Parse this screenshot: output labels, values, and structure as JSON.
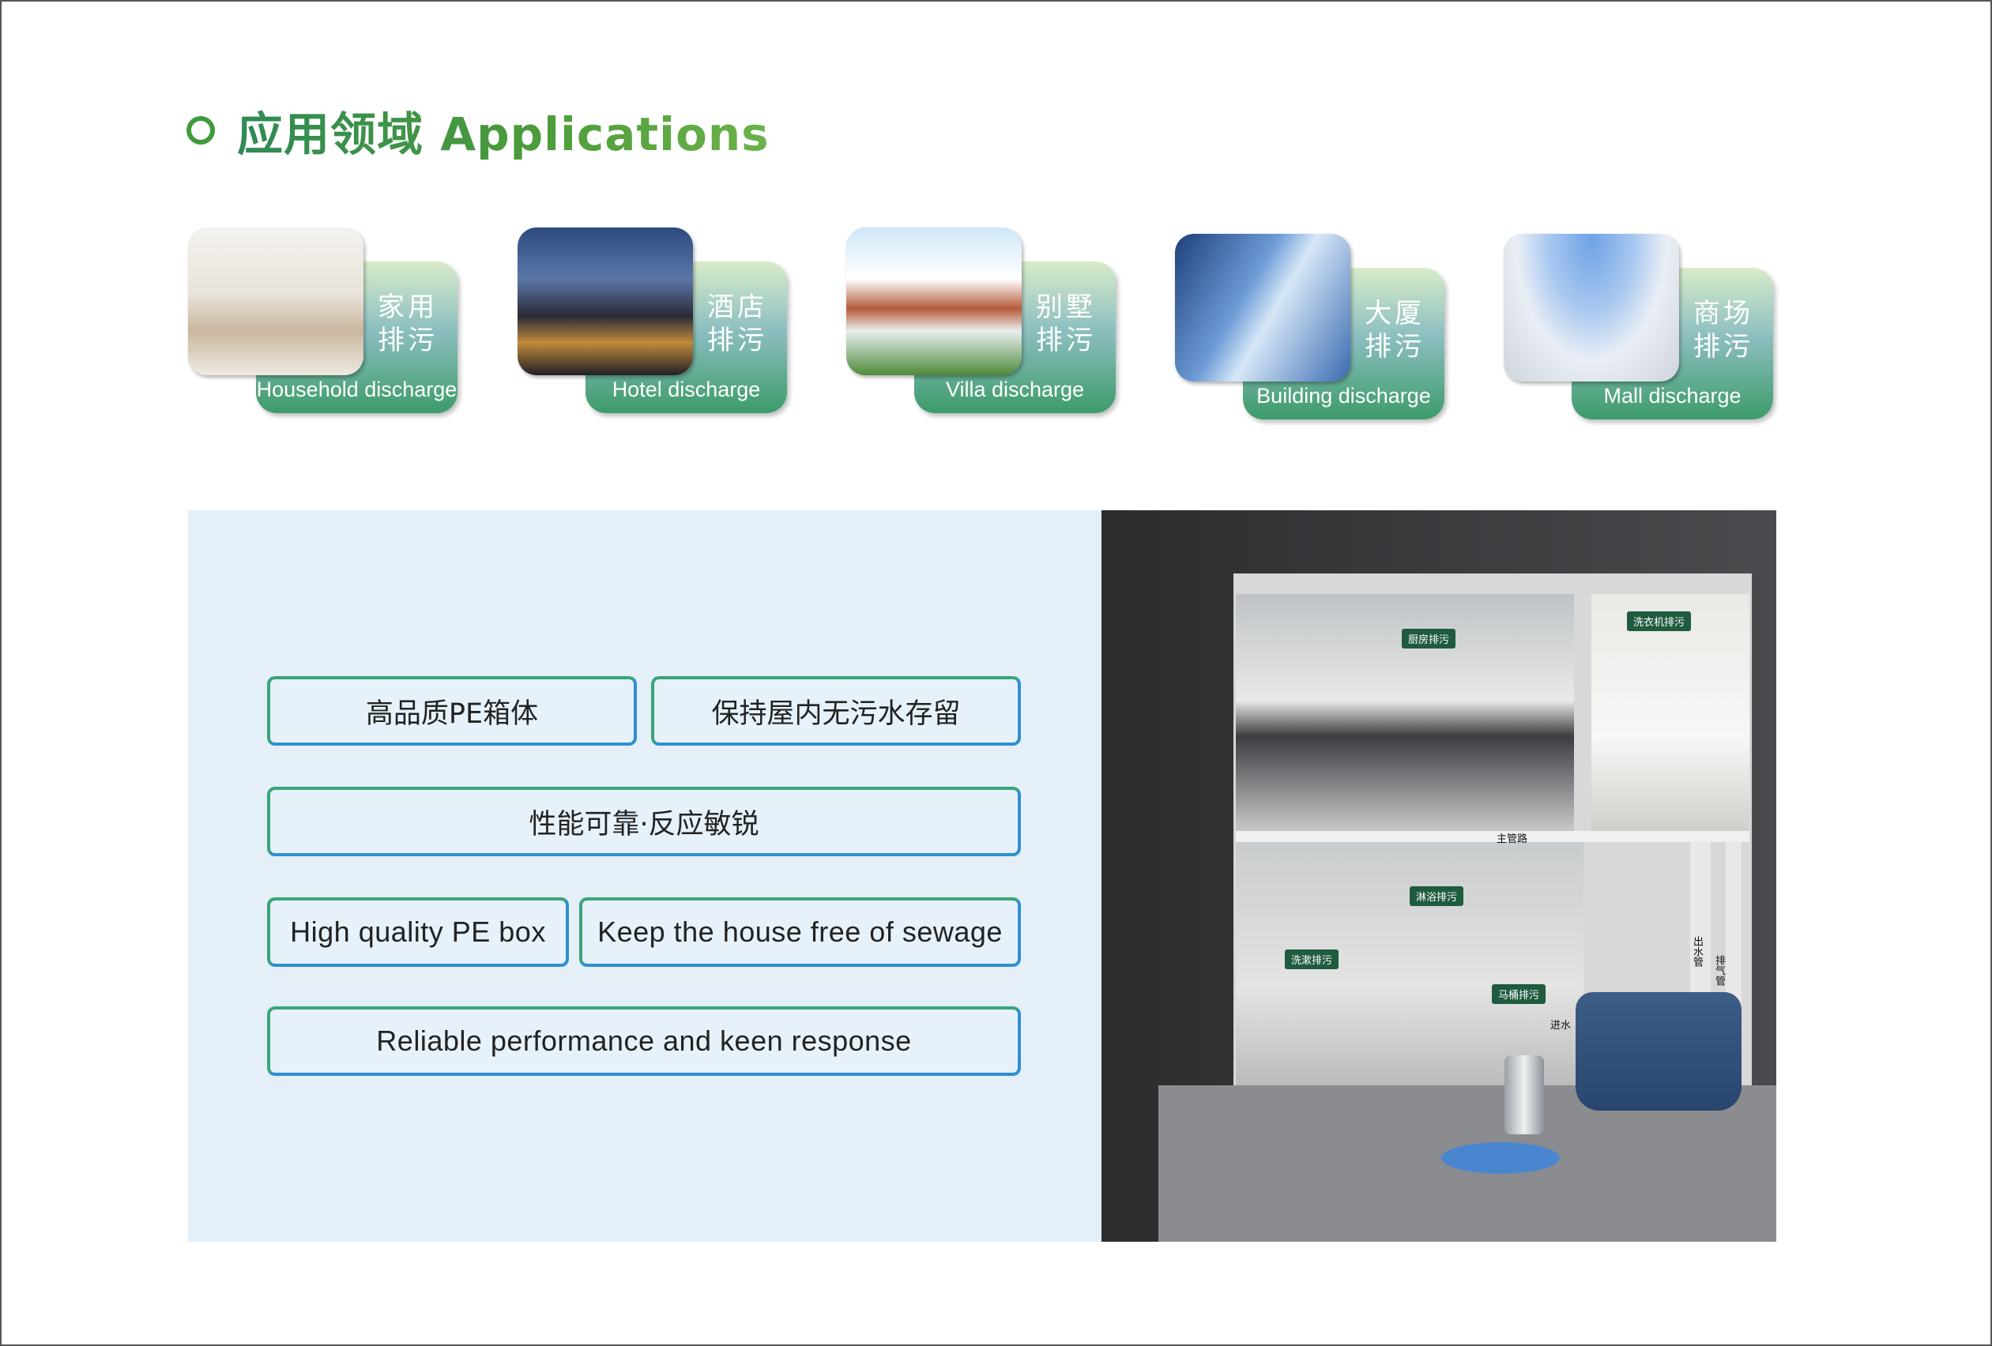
{
  "header": {
    "title": "应用领域 Applications"
  },
  "applications": [
    {
      "cn": "家用\n排污",
      "en": "Household discharge",
      "photo": "living-room"
    },
    {
      "cn": "酒店\n排污",
      "en": "Hotel discharge",
      "photo": "hotel-building"
    },
    {
      "cn": "别墅\n排污",
      "en": "Villa discharge",
      "photo": "villa"
    },
    {
      "cn": "大厦\n排污",
      "en": "Building discharge",
      "photo": "skyscraper"
    },
    {
      "cn": "商场\n排污",
      "en": "Mall discharge",
      "photo": "shopping-mall"
    }
  ],
  "features": {
    "cn_1": "高品质PE箱体",
    "cn_2": "保持屋内无污水存留",
    "cn_3": "性能可靠·反应敏锐",
    "en_1": "High quality PE box",
    "en_2": "Keep the house free of sewage",
    "en_3": "Reliable performance and keen response"
  },
  "illustration": {
    "tags": {
      "kitchen": "厨房排污",
      "washer": "洗衣机排污",
      "main_pipe": "主管路",
      "shower": "淋浴排污",
      "sink": "洗漱排污",
      "toilet": "马桶排污",
      "inlet": "进水",
      "outlet": "出水管",
      "vent": "排气管"
    }
  },
  "colors": {
    "title_green": "#3f9a3c",
    "panel_bg": "#e4eff8",
    "pill_border_green": "#3aa57a",
    "pill_border_blue": "#2f8fcf"
  }
}
